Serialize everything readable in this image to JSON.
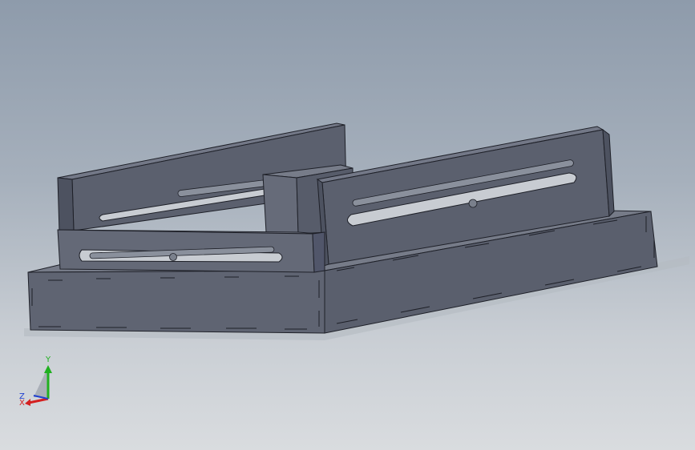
{
  "viewport": {
    "background_top": "#8e9bab",
    "background_bottom": "#d9dcdf"
  },
  "model": {
    "face_color": "#5c6170",
    "top_color": "#6f7482",
    "side_color": "#4d5260",
    "edge_color": "#1e2028",
    "rod_color": "#8a909c"
  },
  "triad": {
    "x_label": "X",
    "y_label": "Y",
    "z_label": "Z",
    "x_color": "#d42020",
    "y_color": "#20b020",
    "z_color": "#2040d0"
  }
}
